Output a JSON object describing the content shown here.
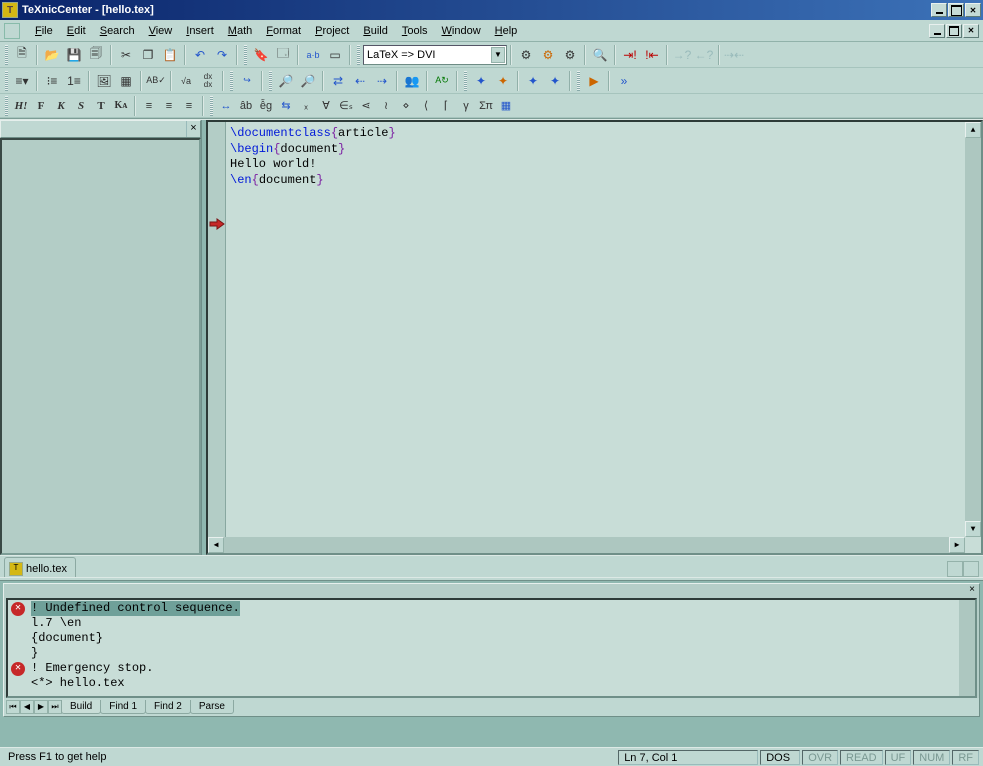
{
  "title": "TeXnicCenter - [hello.tex]",
  "menu": [
    "File",
    "Edit",
    "Search",
    "View",
    "Insert",
    "Math",
    "Format",
    "Project",
    "Build",
    "Tools",
    "Window",
    "Help"
  ],
  "combo": "LaTeX => DVI",
  "editor": {
    "lines": [
      {
        "parts": [
          {
            "t": "\\documentclass",
            "c": "kw"
          },
          {
            "t": "{",
            "c": "br"
          },
          {
            "t": "article"
          },
          {
            "t": "}",
            "c": "br"
          }
        ]
      },
      {
        "parts": [
          {
            "t": ""
          }
        ]
      },
      {
        "parts": [
          {
            "t": "\\begin",
            "c": "kw"
          },
          {
            "t": "{",
            "c": "br"
          },
          {
            "t": "document"
          },
          {
            "t": "}",
            "c": "br"
          }
        ]
      },
      {
        "parts": [
          {
            "t": ""
          }
        ]
      },
      {
        "parts": [
          {
            "t": "Hello world!"
          }
        ]
      },
      {
        "parts": [
          {
            "t": ""
          }
        ]
      },
      {
        "arrow": true,
        "parts": [
          {
            "t": "\\en",
            "c": "kw"
          },
          {
            "t": "{",
            "c": "br"
          },
          {
            "t": "document"
          },
          {
            "t": "}",
            "c": "br"
          }
        ]
      }
    ]
  },
  "filetab": "hello.tex",
  "output": {
    "lines": [
      {
        "err": true,
        "hl": true,
        "text": "! Undefined control sequence."
      },
      {
        "indent": true,
        "text": "l.7 \\en"
      },
      {
        "indent": true,
        "text": "        {document}"
      },
      {
        "indent": true,
        "text": "}"
      },
      {
        "err": true,
        "text": "! Emergency stop."
      },
      {
        "indent": true,
        "text": "<*> hello.tex"
      }
    ],
    "tabs": [
      "Build",
      "Find 1",
      "Find 2",
      "Parse"
    ]
  },
  "status": {
    "help": "Press F1 to get help",
    "pos": "Ln 7, Col 1",
    "enc": "DOS",
    "flags": [
      "OVR",
      "READ",
      "UF",
      "NUM",
      "RF"
    ]
  }
}
